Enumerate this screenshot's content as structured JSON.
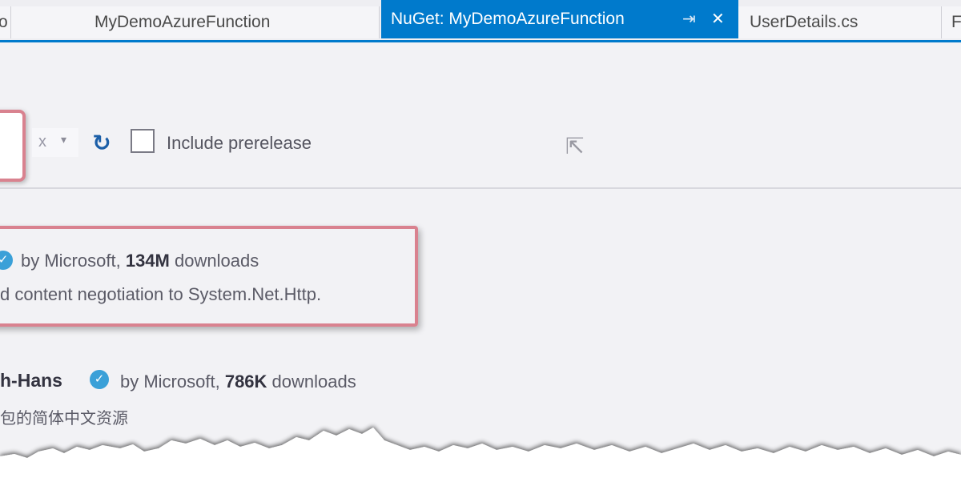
{
  "tabs": {
    "edge_left": "o",
    "project": "MyDemoAzureFunction",
    "active": "NuGet: MyDemoAzureFunction",
    "user_details": "UserDetails.cs",
    "edge_right": "F",
    "pin_glyph": "⇥",
    "close_glyph": "✕"
  },
  "toolbar": {
    "source_value": "x",
    "prerelease_label": "Include prerelease"
  },
  "packages": [
    {
      "author_prefix": "by Microsoft,",
      "downloads_count": "134M",
      "downloads_suffix": "downloads",
      "description": "d content negotiation to System.Net.Http."
    },
    {
      "name": "h-Hans",
      "author_prefix": "by Microsoft,",
      "downloads_count": "786K",
      "downloads_suffix": "downloads",
      "description": "包的简体中文资源"
    }
  ],
  "colors": {
    "accent": "#007acc",
    "highlight_border": "#d9828f",
    "verified_badge": "#3aa0d8"
  }
}
